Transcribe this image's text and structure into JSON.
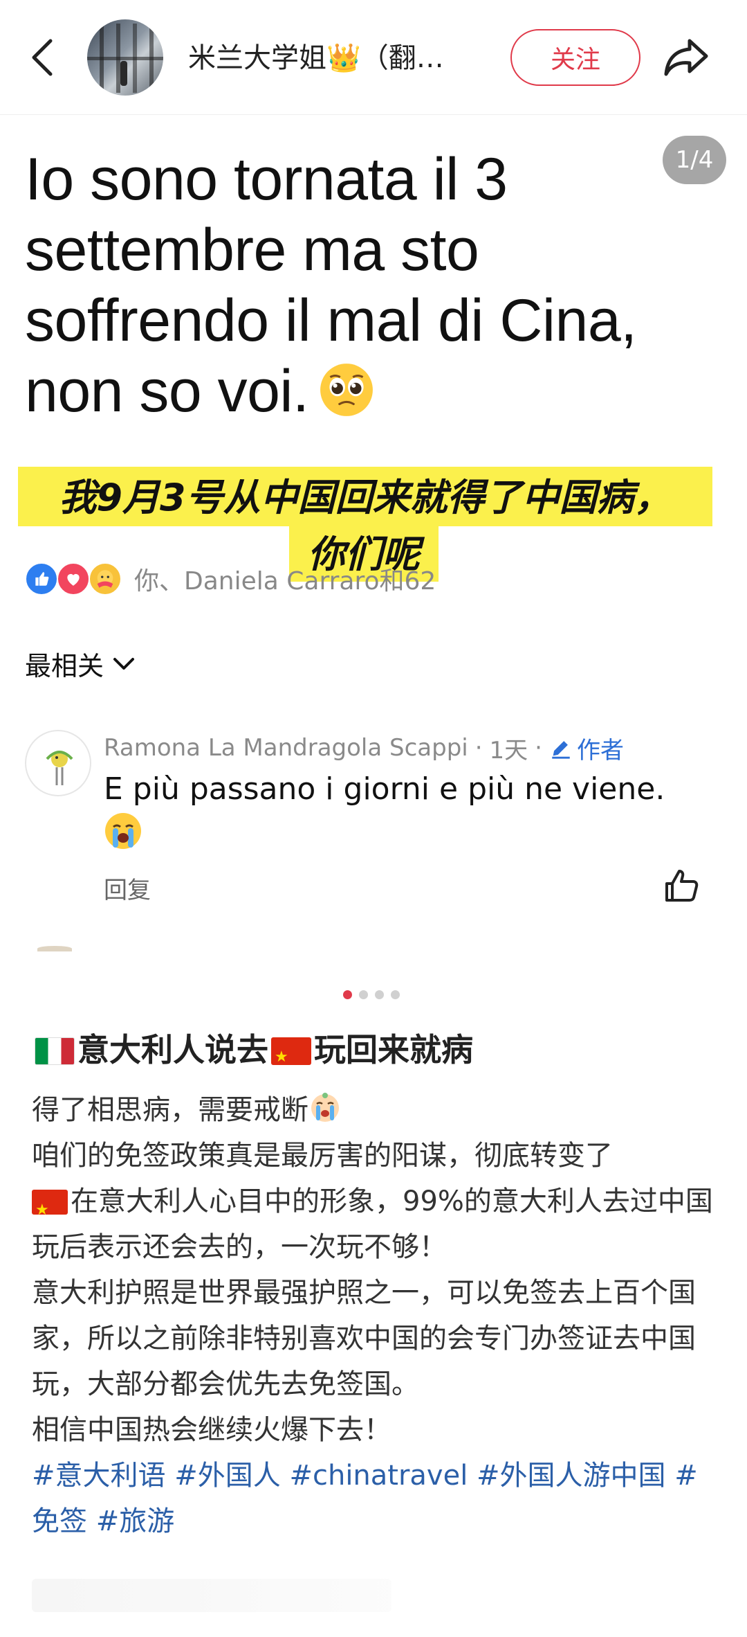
{
  "header": {
    "username": "米兰大学姐👑（翻…",
    "follow_label": "关注"
  },
  "post": {
    "page_counter": "1/4",
    "title": "Io sono tornata il 3 settembre ma sto soffrendo il mal di Cina, non so voi.",
    "highlight_line1": "我9月3号从中国回来就得了中国病，",
    "highlight_line2": "你们呢",
    "reactions_text": "你、Daniela Carraro和62"
  },
  "comments": {
    "sort_label": "最相关",
    "items": [
      {
        "author": "Ramona La Mandragola Scappi",
        "time": "1天",
        "author_badge": "作者",
        "text": "E più passano i giorni e più ne viene.",
        "reply_label": "回复"
      }
    ]
  },
  "carousel": {
    "count": 4,
    "active_index": 0,
    "active_color": "#e03a4a"
  },
  "note": {
    "title_part1": "意大利人说去",
    "title_part2": "玩回来就病",
    "line1": "得了相思病，需要戒断",
    "line2": "咱们的免签政策真是最厉害的阳谋，彻底转变了",
    "line3": "在意大利人心目中的形象，99%的意大利人去过中国玩后表示还会去的，一次玩不够！",
    "line4": "意大利护照是世界最强护照之一，可以免签去上百个国家，所以之前除非特别喜欢中国的会专门办签证去中国玩，大部分都会优先去免签国。",
    "line5": "相信中国热会继续火爆下去！",
    "tags": "#意大利语 #外国人 #chinatravel #外国人游中国 #免签 #旅游"
  },
  "icons": [
    "back-arrow-icon",
    "share-icon",
    "like-reaction-icon",
    "heart-reaction-icon",
    "care-reaction-icon",
    "chevron-down-icon",
    "pen-icon",
    "thumbs-up-icon",
    "italy-flag-icon",
    "china-flag-icon",
    "pleading-face-icon",
    "crying-face-icon"
  ],
  "colors": {
    "accent_red": "#e03a4a",
    "link_blue": "#2b5fa8",
    "highlight_yellow": "#fbf04c"
  }
}
